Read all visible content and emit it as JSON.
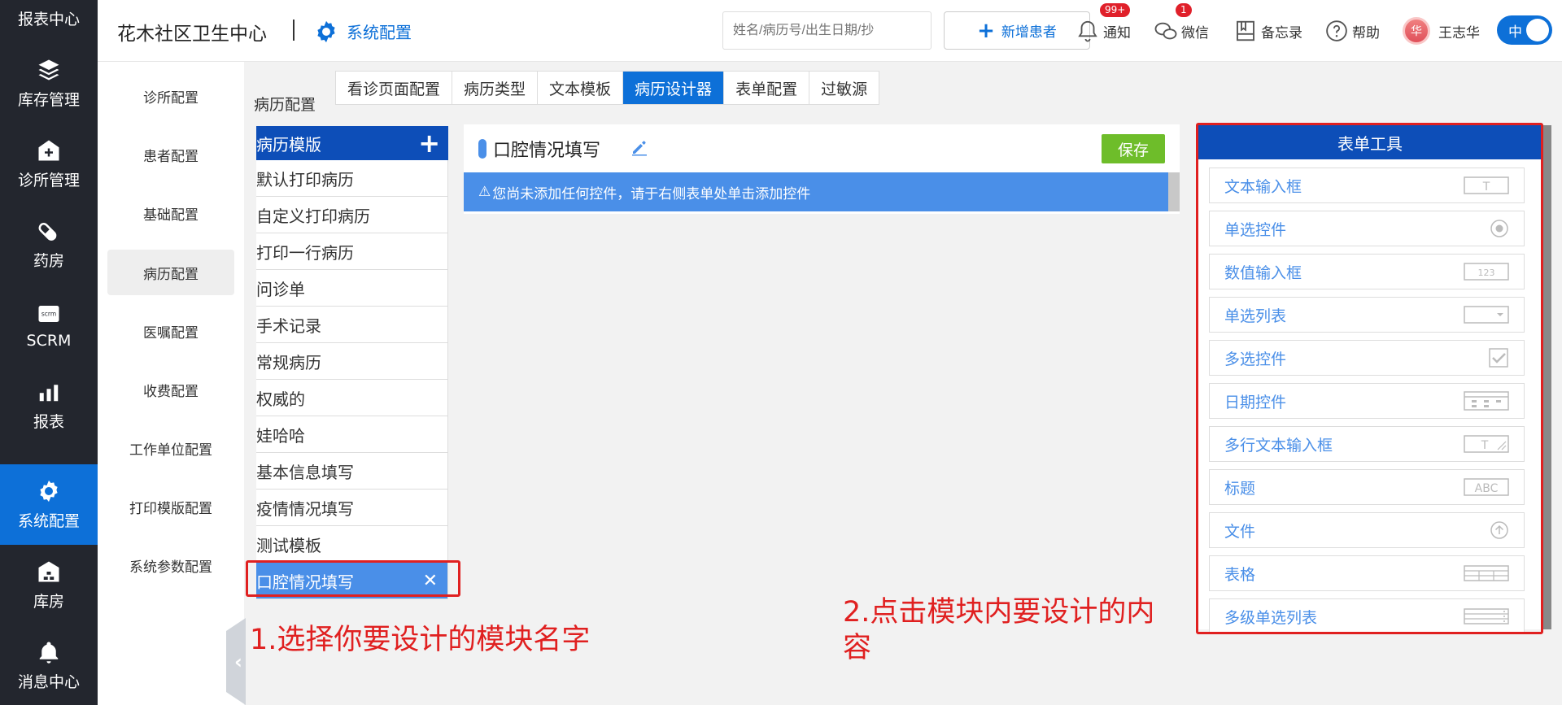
{
  "nav": {
    "items": [
      {
        "label": "报表中心",
        "icon": "bar-chart-icon"
      },
      {
        "label": "库存管理",
        "icon": "layers-icon"
      },
      {
        "label": "诊所管理",
        "icon": "medical-house-icon"
      },
      {
        "label": "药房",
        "icon": "pill-icon"
      },
      {
        "label": "SCRM",
        "icon": "scrm-icon"
      },
      {
        "label": "报表",
        "icon": "bar-chart-icon"
      },
      {
        "label": "系统配置",
        "icon": "gear-icon"
      },
      {
        "label": "库房",
        "icon": "warehouse-icon"
      },
      {
        "label": "消息中心",
        "icon": "bell-icon"
      }
    ]
  },
  "header": {
    "org_name": "花木社区卫生中心",
    "section": "系统配置",
    "search_placeholder": "姓名/病历号/出生日期/抄",
    "add_patient": "新增患者",
    "notify": "通知",
    "notify_badge": "99+",
    "wechat": "微信",
    "wechat_badge": "1",
    "memo": "备忘录",
    "help": "帮助",
    "avatar_char": "华",
    "username": "王志华",
    "lang": "中"
  },
  "submenu": {
    "items": [
      "诊所配置",
      "患者配置",
      "基础配置",
      "病历配置",
      "医嘱配置",
      "收费配置",
      "工作单位配置",
      "打印模版配置",
      "系统参数配置"
    ]
  },
  "content": {
    "breadcrumb": "病历配置",
    "tabs": [
      "看诊页面配置",
      "病历类型",
      "文本模板",
      "病历设计器",
      "表单配置",
      "过敏源"
    ],
    "template_list_title": "病历模版",
    "templates": [
      "默认打印病历",
      "自定义打印病历",
      "打印一行病历",
      "问诊单",
      "手术记录",
      "常规病历",
      "权威的",
      "娃哈哈",
      "基本信息填写",
      "疫情情况填写",
      "测试模板",
      "口腔情况填写"
    ],
    "editor_title": "口腔情况填写",
    "save": "保存",
    "warning": "您尚未添加任何控件，请于右侧表单处单击添加控件",
    "tools_title": "表单工具",
    "tools": [
      {
        "label": "文本输入框",
        "icon": "text-input-icon"
      },
      {
        "label": "单选控件",
        "icon": "radio-icon"
      },
      {
        "label": "数值输入框",
        "icon": "number-input-icon"
      },
      {
        "label": "单选列表",
        "icon": "select-icon"
      },
      {
        "label": "多选控件",
        "icon": "checkbox-icon"
      },
      {
        "label": "日期控件",
        "icon": "date-icon"
      },
      {
        "label": "多行文本输入框",
        "icon": "textarea-icon"
      },
      {
        "label": "标题",
        "icon": "title-abc-icon"
      },
      {
        "label": "文件",
        "icon": "upload-icon"
      },
      {
        "label": "表格",
        "icon": "table-icon"
      },
      {
        "label": "多级单选列表",
        "icon": "cascade-select-icon"
      }
    ]
  },
  "annotations": {
    "step1": "1.选择你要设计的模块名字",
    "step2_line1": "2.点击模块内要设计的内",
    "step2_line2": "容"
  },
  "colors": {
    "nav_bg": "#23262e",
    "primary": "#0d70d8",
    "panel_head": "#0d4eb8",
    "accent_blue": "#4a8fe8",
    "save_green": "#6ebd2a",
    "annotation_red": "#e02020"
  }
}
